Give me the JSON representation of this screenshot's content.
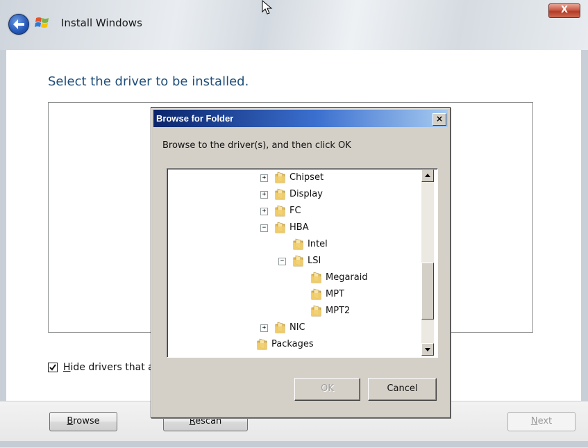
{
  "window": {
    "title": "Install Windows",
    "close_label": "X"
  },
  "main": {
    "heading": "Select the driver to be installed.",
    "hide_drivers_checkbox": {
      "label": "Hide drivers that a",
      "checked": true
    }
  },
  "footer": {
    "browse_label": "Browse",
    "rescan_label": "Rescan",
    "next_label": "Next"
  },
  "dialog": {
    "title": "Browse for Folder",
    "close_label": "×",
    "instruction": "Browse to the driver(s), and then click OK",
    "tree": [
      {
        "label": "Chipset",
        "expander": "+"
      },
      {
        "label": "Display",
        "expander": "+"
      },
      {
        "label": "FC",
        "expander": "+"
      },
      {
        "label": "HBA",
        "expander": "−"
      },
      {
        "label": "Intel",
        "expander": ""
      },
      {
        "label": "LSI",
        "expander": "−"
      },
      {
        "label": "Megaraid",
        "expander": ""
      },
      {
        "label": "MPT",
        "expander": ""
      },
      {
        "label": "MPT2",
        "expander": ""
      },
      {
        "label": "NIC",
        "expander": "+"
      },
      {
        "label": "Packages",
        "expander": ""
      }
    ],
    "ok_label": "OK",
    "cancel_label": "Cancel"
  },
  "colors": {
    "heading": "#1f4e79",
    "dialog_title_start": "#0a246a",
    "dialog_title_end": "#a6caf0",
    "folder": "#e8c15a"
  },
  "icons": {
    "back": "back-arrow-icon",
    "logo": "windows-logo-icon",
    "folder": "folder-icon",
    "cursor": "mouse-cursor-icon"
  }
}
